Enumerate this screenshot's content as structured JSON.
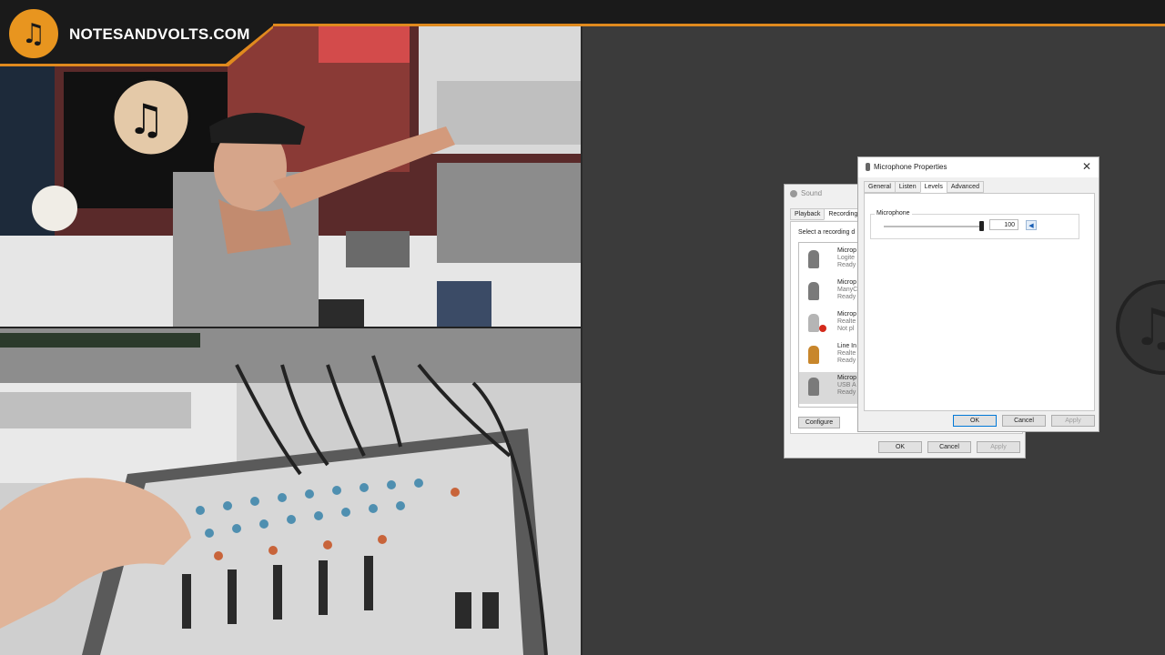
{
  "brand": {
    "name": "NOTESANDVOLTS.COM",
    "logo_icon": "music-note-icon",
    "accent": "#e08a1e"
  },
  "sound_dialog": {
    "title": "Sound",
    "tabs": [
      "Playback",
      "Recording"
    ],
    "hint": "Select a recording d",
    "devices": [
      {
        "line1": "Microp",
        "line2": "Logite",
        "line3": "Ready",
        "icon": "microphone-icon"
      },
      {
        "line1": "Microp",
        "line2": "ManyC",
        "line3": "Ready",
        "icon": "microphone-icon"
      },
      {
        "line1": "Microp",
        "line2": "Realte",
        "line3": "Not pl",
        "icon": "microphone-unplugged-icon"
      },
      {
        "line1": "Line In",
        "line2": "Realte",
        "line3": "Ready",
        "icon": "line-in-icon"
      },
      {
        "line1": "Microp",
        "line2": "USB A",
        "line3": "Ready",
        "icon": "microphone-icon"
      }
    ],
    "configure": "Configure",
    "ok": "OK",
    "cancel": "Cancel",
    "apply": "Apply"
  },
  "mic_props": {
    "title": "Microphone Properties",
    "close": "✕",
    "tabs": [
      "General",
      "Listen",
      "Levels",
      "Advanced"
    ],
    "group_label": "Microphone",
    "level_value": "100",
    "level_fraction": 1.0,
    "ok": "OK",
    "cancel": "Cancel",
    "apply": "Apply"
  }
}
